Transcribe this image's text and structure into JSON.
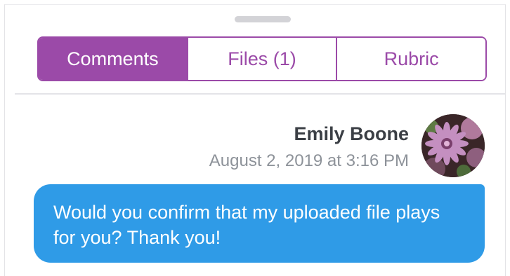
{
  "tabs": [
    {
      "label": "Comments",
      "active": true
    },
    {
      "label": "Files (1)",
      "active": false
    },
    {
      "label": "Rubric",
      "active": false
    }
  ],
  "comment": {
    "author": "Emily Boone",
    "timestamp": "August 2, 2019 at 3:16 PM",
    "message": "Would you confirm that my uploaded file plays for you? Thank you!",
    "avatar_icon": "flower-photo-avatar"
  },
  "colors": {
    "accent": "#9b4aa8",
    "bubble": "#2f9be7",
    "author_text": "#3b3f45",
    "timestamp_text": "#8d9299"
  }
}
